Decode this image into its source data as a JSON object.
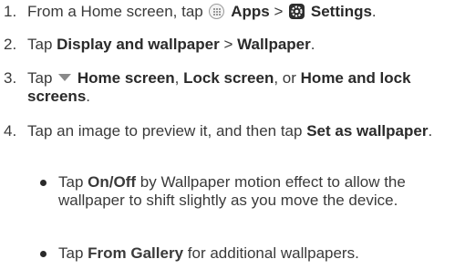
{
  "steps": [
    {
      "num": "1.",
      "parts": [
        "From a Home screen, tap",
        "Apps",
        ">",
        "Settings",
        "."
      ]
    },
    {
      "num": "2.",
      "parts": [
        "Tap",
        "Display and wallpaper",
        ">",
        "Wallpaper",
        "."
      ]
    },
    {
      "num": "3.",
      "parts": [
        "Tap",
        "Home screen",
        ", ",
        "Lock screen",
        ", or",
        "Home and lock screens",
        "."
      ]
    },
    {
      "num": "4.",
      "parts": [
        "Tap an image to preview it, and then tap",
        "Set as wallpaper",
        "."
      ]
    }
  ],
  "bullets": [
    {
      "parts": [
        "Tap",
        "On/Off",
        "by Wallpaper motion effect to allow the wallpaper to shift slightly as you move the device."
      ]
    },
    {
      "parts": [
        "Tap",
        "From Gallery",
        "for additional wallpapers."
      ]
    }
  ],
  "icons": {
    "apps": "apps-grid-icon",
    "settings": "settings-gear-icon",
    "dropdown": "dropdown-triangle-icon"
  }
}
